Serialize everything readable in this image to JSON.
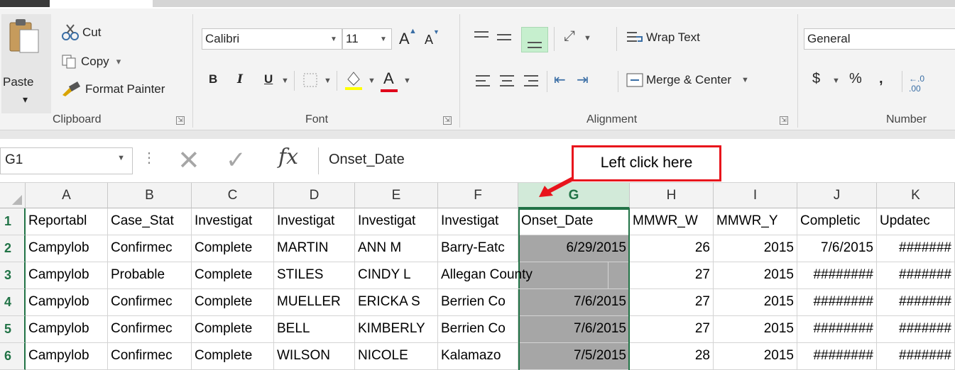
{
  "ribbon": {
    "clipboard": {
      "paste_label": "Paste",
      "paste_dd": "▾",
      "cut_label": "Cut",
      "copy_label": "Copy",
      "copy_dd": "▾",
      "format_painter_label": "Format Painter",
      "group_label": "Clipboard"
    },
    "font": {
      "font_name": "Calibri",
      "font_size": "11",
      "bold": "B",
      "italic": "I",
      "underline": "U",
      "grow": "A",
      "shrink": "A",
      "font_color": "A",
      "group_label": "Font"
    },
    "alignment": {
      "wrap_text_label": "Wrap Text",
      "merge_center_label": "Merge & Center",
      "group_label": "Alignment"
    },
    "number": {
      "format": "General",
      "currency": "$",
      "percent": "%",
      "comma": ",",
      "group_label": "Number"
    },
    "accent_color": "#217346",
    "highlight_color": "#c6efce"
  },
  "formula_bar": {
    "name_box": "G1",
    "fx": "fx",
    "cancel": "✕",
    "enter": "✓",
    "formula": "Onset_Date"
  },
  "callout": {
    "text": "Left click here",
    "color": "#e8141c"
  },
  "grid": {
    "columns": [
      "A",
      "B",
      "C",
      "D",
      "E",
      "F",
      "G",
      "H",
      "I",
      "J",
      "K"
    ],
    "selected_column": "G",
    "rows": [
      {
        "n": "1",
        "cells": [
          "Reportabl",
          "Case_Stat",
          "Investigat",
          "Investigat",
          "Investigat",
          "Investigat",
          "Onset_Date",
          "MMWR_W",
          "MMWR_Y",
          "Completic",
          "Updatec"
        ]
      },
      {
        "n": "2",
        "cells": [
          "Campylob",
          "Confirmec",
          "Complete",
          "MARTIN",
          "ANN M",
          "Barry-Eatc",
          "6/29/2015",
          "26",
          "2015",
          "7/6/2015",
          "#######"
        ]
      },
      {
        "n": "3",
        "cells": [
          "Campylob",
          "Probable",
          "Complete",
          "STILES",
          "CINDY L",
          "Allegan County",
          "",
          "27",
          "2015",
          "########",
          "#######"
        ]
      },
      {
        "n": "4",
        "cells": [
          "Campylob",
          "Confirmec",
          "Complete",
          "MUELLER",
          "ERICKA S",
          "Berrien Co",
          "7/6/2015",
          "27",
          "2015",
          "########",
          "#######"
        ]
      },
      {
        "n": "5",
        "cells": [
          "Campylob",
          "Confirmec",
          "Complete",
          "BELL",
          "KIMBERLY",
          "Berrien Co",
          "7/6/2015",
          "27",
          "2015",
          "########",
          "#######"
        ]
      },
      {
        "n": "6",
        "cells": [
          "Campylob",
          "Confirmec",
          "Complete",
          "WILSON",
          "NICOLE",
          "Kalamazo",
          "7/5/2015",
          "28",
          "2015",
          "########",
          "#######"
        ]
      }
    ]
  }
}
